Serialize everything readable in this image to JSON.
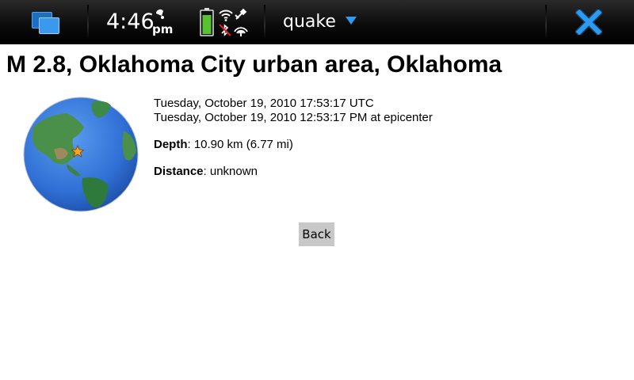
{
  "statusbar": {
    "time": "4:46",
    "ampm": "pm",
    "app_name": "quake",
    "icons": [
      "task-switcher-icon",
      "alarm-icon",
      "battery-icon",
      "wifi-icon",
      "gps-icon",
      "bluetooth-off-icon",
      "signal-icon",
      "close-icon"
    ],
    "battery_level": 0.8,
    "colors": {
      "accent": "#2f9bf0",
      "battery": "#58c231",
      "close": "#2f9bf0"
    }
  },
  "quake": {
    "title": "M 2.8, Oklahoma City urban area, Oklahoma",
    "utc_time": "Tuesday, October 19, 2010 17:53:17 UTC",
    "local_time": "Tuesday, October 19, 2010 12:53:17 PM at epicenter",
    "depth_label": "Depth",
    "depth_value": ": 10.90 km (6.77 mi)",
    "distance_label": "Distance",
    "distance_value": ": unknown",
    "map_icon": "globe-map-with-star-marker"
  },
  "actions": {
    "back_label": "Back"
  }
}
